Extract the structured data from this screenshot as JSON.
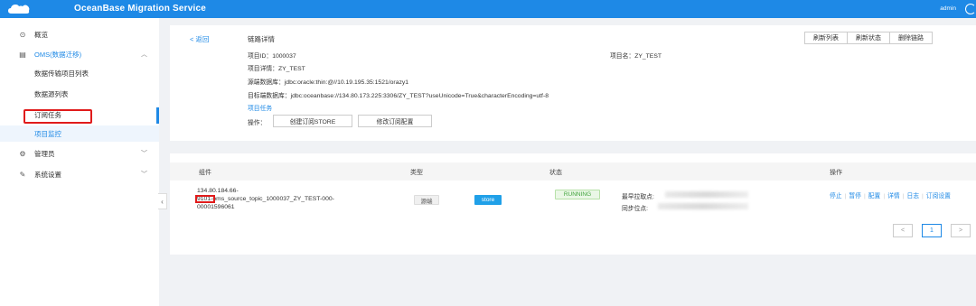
{
  "header": {
    "title": "OceanBase Migration Service",
    "user": "admin"
  },
  "sidebar": {
    "items": [
      {
        "label": "概览",
        "icon": "dashboard-icon"
      },
      {
        "label": "OMS(数据迁移)",
        "icon": "database-icon"
      },
      {
        "label": "数据传输项目列表"
      },
      {
        "label": "数据源列表"
      },
      {
        "label": "订阅任务"
      },
      {
        "label": "项目监控"
      },
      {
        "label": "管理员",
        "icon": "gear-icon"
      },
      {
        "label": "系统设置",
        "icon": "wrench-icon"
      }
    ]
  },
  "detail": {
    "back": "< 返回",
    "title": "链路详情",
    "buttons": [
      "刷新列表",
      "刷新状态",
      "删除链路"
    ],
    "project_id_label": "项目ID：",
    "project_id": "1000037",
    "project_name_label": "项目名：",
    "project_name": "ZY_TEST",
    "project_detail_label": "项目详情：",
    "project_detail": "ZY_TEST",
    "source_label": "源端数据库：",
    "source": "jdbc:oracle:thin:@//10.19.195.35:1521/orazy1",
    "target_label": "目标端数据库：",
    "target": "jdbc:oceanbase://134.80.173.225:3306/ZY_TEST?useUnicode=True&characterEncoding=utf-8",
    "project_task": "项目任务",
    "op_label": "操作：",
    "op_buttons": [
      "创建订阅STORE",
      "修改订阅配置"
    ]
  },
  "table": {
    "headers": [
      "组件",
      "类型",
      "状态",
      "操作"
    ],
    "row": {
      "component_line1": "134.80.184.66-",
      "component_line2": "9101-oms_source_topic_1000037_ZY_TEST-000-",
      "component_line3": "00001596061",
      "type": "源端",
      "store": "store",
      "status": "RUNNING",
      "pull_label": "最早拉取点:",
      "sync_label": "同步位点:",
      "actions": [
        "停止",
        "暂停",
        "配置",
        "详情",
        "日志",
        "订阅设置"
      ]
    }
  },
  "pagination": {
    "prev": "<",
    "current": "1",
    "next": ">"
  },
  "colors": {
    "primary": "#1e89e6",
    "highlight": "#e01b1b",
    "running": "#3fa33a"
  }
}
